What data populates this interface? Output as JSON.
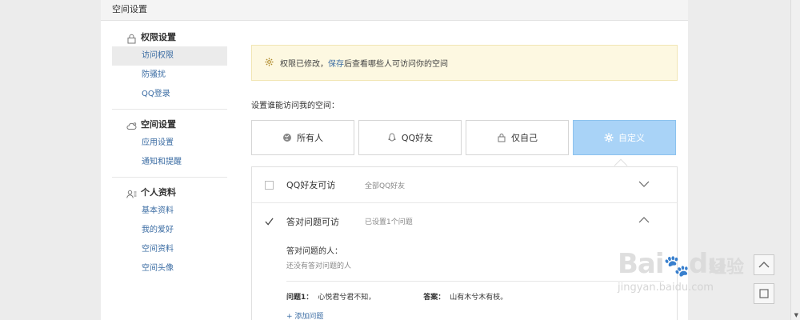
{
  "panel": {
    "title": "空间设置"
  },
  "sidebar": {
    "groups": [
      {
        "title": "权限设置",
        "icon": "lock-icon",
        "items": [
          {
            "label": "访问权限",
            "active": true
          },
          {
            "label": "防骚扰"
          },
          {
            "label": "QQ登录"
          }
        ]
      },
      {
        "title": "空间设置",
        "icon": "cloud-settings-icon",
        "items": [
          {
            "label": "应用设置"
          },
          {
            "label": "通知和提醒"
          }
        ]
      },
      {
        "title": "个人资料",
        "icon": "profile-card-icon",
        "items": [
          {
            "label": "基本资料"
          },
          {
            "label": "我的爱好"
          },
          {
            "label": "空间资料"
          },
          {
            "label": "空间头像"
          }
        ]
      }
    ]
  },
  "notice": {
    "before": "权限已修改，",
    "link": "保存",
    "after": "后查看哪些人可访问你的空间"
  },
  "who_label": "设置谁能访问我的空间：",
  "options": [
    {
      "label": "所有人",
      "icon": "globe-icon"
    },
    {
      "label": "QQ好友",
      "icon": "qq-penguin-icon"
    },
    {
      "label": "仅自己",
      "icon": "lock-icon"
    },
    {
      "label": "自定义",
      "icon": "gear-icon",
      "selected": true
    }
  ],
  "rules": [
    {
      "name": "QQ好友可访",
      "desc": "全部QQ好友",
      "checked": false,
      "expanded": false
    },
    {
      "name": "答对问题可访",
      "desc": "已设置1个问题",
      "checked": true,
      "expanded": true
    }
  ],
  "expanded": {
    "title": "答对问题的人：",
    "empty": "还没有答对问题的人",
    "question_key": "问题1：",
    "question": "心悦君兮君不知，",
    "answer_key": "答案：",
    "answer": "山有木兮木有枝。",
    "add": "+ 添加问题"
  },
  "watermark": {
    "brand": "Bai",
    "brand2": "du",
    "cn": "经验",
    "url": "jingyan.baidu.com"
  },
  "colors": {
    "selected_option": "#a9d3f7",
    "link": "#3b6ca3",
    "notice_bg": "#fdf8e1"
  }
}
